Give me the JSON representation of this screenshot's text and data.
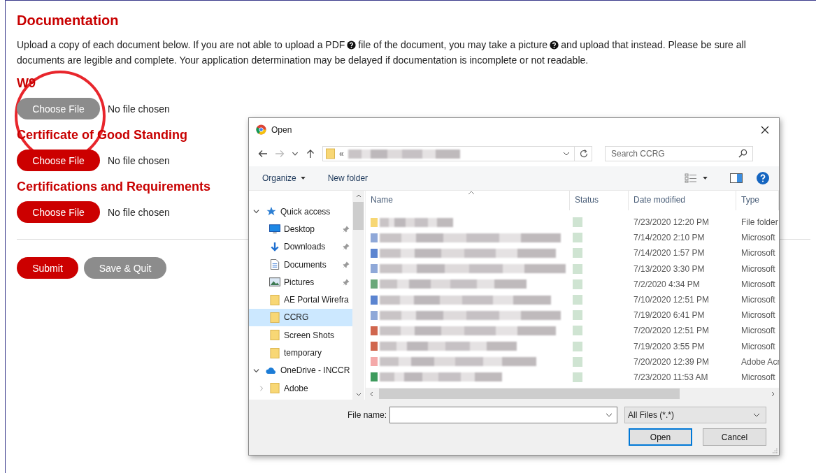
{
  "page": {
    "title": "Documentation",
    "instructions": [
      [
        "Upload a copy of each document below. If you are not able to upload a PDF",
        "file of the document, you may take a picture",
        "and upload that instead. Please be sure all"
      ],
      [
        "documents are legible and complete. Your application determination may be delayed if documentation is incomplete or not readable."
      ]
    ],
    "uploads": [
      {
        "label": "W9",
        "button": "Choose File",
        "status": "No file chosen",
        "highlighted": true
      },
      {
        "label": "Certificate of Good Standing",
        "button": "Choose File",
        "status": "No file chosen",
        "highlighted": false
      },
      {
        "label": "Certifications and Requirements",
        "button": "Choose File",
        "status": "No file chosen",
        "highlighted": false
      }
    ],
    "actions": [
      {
        "label": "Submit",
        "disabled": false
      },
      {
        "label": "Save & Quit",
        "disabled": true
      }
    ]
  },
  "dialog": {
    "title": "Open",
    "path_prefix": "«",
    "search": {
      "placeholder": "Search CCRG"
    },
    "toolbar": [
      "Organize",
      "New folder"
    ],
    "sidebar": [
      {
        "label": "Quick access",
        "kind": "star",
        "expanded": true,
        "selected": false,
        "children": [
          {
            "label": "Desktop",
            "kind": "desktop",
            "pinned": true,
            "selected": false
          },
          {
            "label": "Downloads",
            "kind": "download",
            "pinned": true,
            "selected": false
          },
          {
            "label": "Documents",
            "kind": "document",
            "pinned": true,
            "selected": false
          },
          {
            "label": "Pictures",
            "kind": "picture",
            "pinned": true,
            "selected": false
          },
          {
            "label": "AE Portal Wirefra",
            "kind": "folder",
            "pinned": false,
            "selected": false
          },
          {
            "label": "CCRG",
            "kind": "folder",
            "pinned": false,
            "selected": true
          },
          {
            "label": "Screen Shots",
            "kind": "folder",
            "pinned": false,
            "selected": false
          },
          {
            "label": "temporary",
            "kind": "folder",
            "pinned": false,
            "selected": false
          }
        ]
      },
      {
        "label": "OneDrive - INCCR",
        "kind": "cloud",
        "expanded": true,
        "selected": false,
        "children": [
          {
            "label": "Adobe",
            "kind": "folder",
            "pinned": false,
            "selected": false,
            "expanded": false
          }
        ]
      }
    ],
    "columns": [
      "Name",
      "Status",
      "Date modified",
      "Type"
    ],
    "files": [
      {
        "color": "#f7d774",
        "date": "7/23/2020 12:20 PM",
        "type": "File folder"
      },
      {
        "color": "#8fa8d8",
        "date": "7/14/2020 2:10 PM",
        "type": "Microsoft"
      },
      {
        "color": "#5b84d0",
        "date": "7/14/2020 1:57 PM",
        "type": "Microsoft"
      },
      {
        "color": "#8fa8d8",
        "date": "7/13/2020 3:30 PM",
        "type": "Microsoft"
      },
      {
        "color": "#6aa87a",
        "date": "7/2/2020 4:34 PM",
        "type": "Microsoft"
      },
      {
        "color": "#5b84d0",
        "date": "7/10/2020 12:51 PM",
        "type": "Microsoft"
      },
      {
        "color": "#8fa8d8",
        "date": "7/19/2020 6:41 PM",
        "type": "Microsoft"
      },
      {
        "color": "#d0664e",
        "date": "7/20/2020 12:51 PM",
        "type": "Microsoft"
      },
      {
        "color": "#d0664e",
        "date": "7/19/2020 3:55 PM",
        "type": "Microsoft"
      },
      {
        "color": "#f4a9a9",
        "date": "7/20/2020 12:39 PM",
        "type": "Adobe Acr"
      },
      {
        "color": "#3d9a5c",
        "date": "7/23/2020 11:53 AM",
        "type": "Microsoft"
      }
    ],
    "file_name_label": "File name:",
    "file_filter": "All Files (*.*)",
    "buttons": [
      {
        "label": "Open",
        "default": true
      },
      {
        "label": "Cancel",
        "default": false
      }
    ]
  }
}
